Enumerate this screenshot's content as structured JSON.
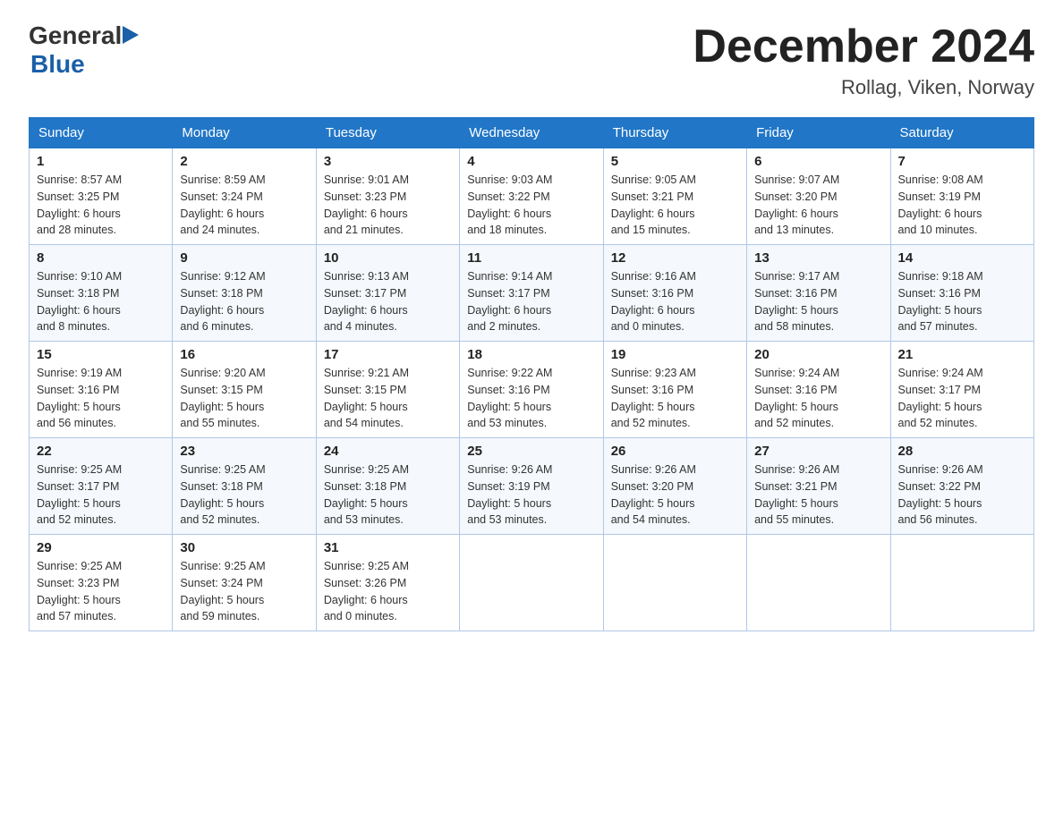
{
  "header": {
    "logo_general": "General",
    "logo_blue": "Blue",
    "title": "December 2024",
    "subtitle": "Rollag, Viken, Norway"
  },
  "weekdays": [
    "Sunday",
    "Monday",
    "Tuesday",
    "Wednesday",
    "Thursday",
    "Friday",
    "Saturday"
  ],
  "weeks": [
    [
      {
        "day": "1",
        "sunrise": "8:57 AM",
        "sunset": "3:25 PM",
        "daylight": "6 hours and 28 minutes."
      },
      {
        "day": "2",
        "sunrise": "8:59 AM",
        "sunset": "3:24 PM",
        "daylight": "6 hours and 24 minutes."
      },
      {
        "day": "3",
        "sunrise": "9:01 AM",
        "sunset": "3:23 PM",
        "daylight": "6 hours and 21 minutes."
      },
      {
        "day": "4",
        "sunrise": "9:03 AM",
        "sunset": "3:22 PM",
        "daylight": "6 hours and 18 minutes."
      },
      {
        "day": "5",
        "sunrise": "9:05 AM",
        "sunset": "3:21 PM",
        "daylight": "6 hours and 15 minutes."
      },
      {
        "day": "6",
        "sunrise": "9:07 AM",
        "sunset": "3:20 PM",
        "daylight": "6 hours and 13 minutes."
      },
      {
        "day": "7",
        "sunrise": "9:08 AM",
        "sunset": "3:19 PM",
        "daylight": "6 hours and 10 minutes."
      }
    ],
    [
      {
        "day": "8",
        "sunrise": "9:10 AM",
        "sunset": "3:18 PM",
        "daylight": "6 hours and 8 minutes."
      },
      {
        "day": "9",
        "sunrise": "9:12 AM",
        "sunset": "3:18 PM",
        "daylight": "6 hours and 6 minutes."
      },
      {
        "day": "10",
        "sunrise": "9:13 AM",
        "sunset": "3:17 PM",
        "daylight": "6 hours and 4 minutes."
      },
      {
        "day": "11",
        "sunrise": "9:14 AM",
        "sunset": "3:17 PM",
        "daylight": "6 hours and 2 minutes."
      },
      {
        "day": "12",
        "sunrise": "9:16 AM",
        "sunset": "3:16 PM",
        "daylight": "6 hours and 0 minutes."
      },
      {
        "day": "13",
        "sunrise": "9:17 AM",
        "sunset": "3:16 PM",
        "daylight": "5 hours and 58 minutes."
      },
      {
        "day": "14",
        "sunrise": "9:18 AM",
        "sunset": "3:16 PM",
        "daylight": "5 hours and 57 minutes."
      }
    ],
    [
      {
        "day": "15",
        "sunrise": "9:19 AM",
        "sunset": "3:16 PM",
        "daylight": "5 hours and 56 minutes."
      },
      {
        "day": "16",
        "sunrise": "9:20 AM",
        "sunset": "3:15 PM",
        "daylight": "5 hours and 55 minutes."
      },
      {
        "day": "17",
        "sunrise": "9:21 AM",
        "sunset": "3:15 PM",
        "daylight": "5 hours and 54 minutes."
      },
      {
        "day": "18",
        "sunrise": "9:22 AM",
        "sunset": "3:16 PM",
        "daylight": "5 hours and 53 minutes."
      },
      {
        "day": "19",
        "sunrise": "9:23 AM",
        "sunset": "3:16 PM",
        "daylight": "5 hours and 52 minutes."
      },
      {
        "day": "20",
        "sunrise": "9:24 AM",
        "sunset": "3:16 PM",
        "daylight": "5 hours and 52 minutes."
      },
      {
        "day": "21",
        "sunrise": "9:24 AM",
        "sunset": "3:17 PM",
        "daylight": "5 hours and 52 minutes."
      }
    ],
    [
      {
        "day": "22",
        "sunrise": "9:25 AM",
        "sunset": "3:17 PM",
        "daylight": "5 hours and 52 minutes."
      },
      {
        "day": "23",
        "sunrise": "9:25 AM",
        "sunset": "3:18 PM",
        "daylight": "5 hours and 52 minutes."
      },
      {
        "day": "24",
        "sunrise": "9:25 AM",
        "sunset": "3:18 PM",
        "daylight": "5 hours and 53 minutes."
      },
      {
        "day": "25",
        "sunrise": "9:26 AM",
        "sunset": "3:19 PM",
        "daylight": "5 hours and 53 minutes."
      },
      {
        "day": "26",
        "sunrise": "9:26 AM",
        "sunset": "3:20 PM",
        "daylight": "5 hours and 54 minutes."
      },
      {
        "day": "27",
        "sunrise": "9:26 AM",
        "sunset": "3:21 PM",
        "daylight": "5 hours and 55 minutes."
      },
      {
        "day": "28",
        "sunrise": "9:26 AM",
        "sunset": "3:22 PM",
        "daylight": "5 hours and 56 minutes."
      }
    ],
    [
      {
        "day": "29",
        "sunrise": "9:25 AM",
        "sunset": "3:23 PM",
        "daylight": "5 hours and 57 minutes."
      },
      {
        "day": "30",
        "sunrise": "9:25 AM",
        "sunset": "3:24 PM",
        "daylight": "5 hours and 59 minutes."
      },
      {
        "day": "31",
        "sunrise": "9:25 AM",
        "sunset": "3:26 PM",
        "daylight": "6 hours and 0 minutes."
      },
      null,
      null,
      null,
      null
    ]
  ],
  "labels": {
    "sunrise": "Sunrise:",
    "sunset": "Sunset:",
    "daylight": "Daylight:"
  }
}
